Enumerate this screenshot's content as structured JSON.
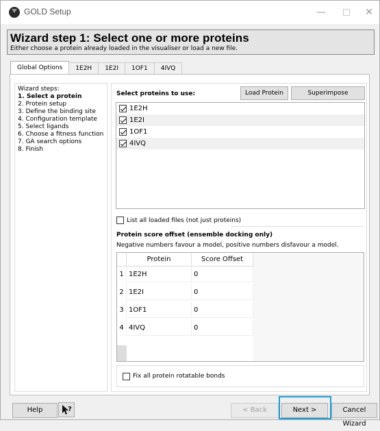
{
  "window": {
    "title": "GOLD Setup",
    "minimize_glyph": "—",
    "close_glyph": "✕"
  },
  "header": {
    "title": "Wizard step 1: Select one or more proteins",
    "subtitle": "Either choose a protein already loaded in the visualiser or load a new file."
  },
  "tabs": [
    {
      "label": "Global Options",
      "active": true
    },
    {
      "label": "1E2H"
    },
    {
      "label": "1E2I"
    },
    {
      "label": "1OF1"
    },
    {
      "label": "4IVQ"
    }
  ],
  "steps": {
    "title": "Wizard steps:",
    "items": [
      "1. Select a protein",
      "2. Protein setup",
      "3. Define the binding site",
      "4. Configuration template",
      "5. Select ligands",
      "6. Choose a fitness function",
      "7. GA search options",
      "8. Finish"
    ]
  },
  "main": {
    "select_label": "Select proteins to use:",
    "load_button": "Load Protein",
    "superimpose_button": "Superimpose Proteins...",
    "proteins": [
      {
        "name": "1E2H",
        "checked": true
      },
      {
        "name": "1E2I",
        "checked": true
      },
      {
        "name": "1OF1",
        "checked": true
      },
      {
        "name": "4IVQ",
        "checked": true
      }
    ],
    "list_all_label": "List all loaded files (not just proteins)",
    "list_all_checked": false,
    "score_title": "Protein score offset (ensemble docking only)",
    "score_desc": "Negative numbers favour a model, positive numbers disfavour a model.",
    "table_headers": [
      "Protein",
      "Score Offset"
    ],
    "table_rows": [
      {
        "num": "1",
        "protein": "1E2H",
        "offset": "0"
      },
      {
        "num": "2",
        "protein": "1E2I",
        "offset": "0"
      },
      {
        "num": "3",
        "protein": "1OF1",
        "offset": "0"
      },
      {
        "num": "4",
        "protein": "4IVQ",
        "offset": "0"
      }
    ],
    "fix_bonds_label": "Fix all protein rotatable bonds",
    "fix_bonds_checked": false
  },
  "footer": {
    "help": "Help",
    "back": "< Back",
    "next": "Next >",
    "cancel": "Cancel Wizard"
  },
  "colors": {
    "focus_highlight": "#1a9bd7"
  }
}
